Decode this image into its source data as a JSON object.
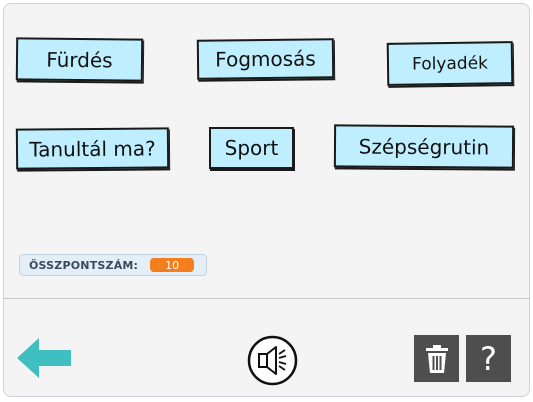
{
  "words": [
    {
      "label": "Fürdés"
    },
    {
      "label": "Fogmosás"
    },
    {
      "label": "Folyadék"
    },
    {
      "label": "Tanultál ma?"
    },
    {
      "label": "Sport"
    },
    {
      "label": "Szépségrutin"
    }
  ],
  "score": {
    "label": "ÖSSZPONTSZÁM:",
    "value": "10"
  },
  "controls": {
    "back_icon": "arrow-left-icon",
    "sound_icon": "speaker-icon",
    "trash_icon": "trash-icon",
    "help_label": "?"
  },
  "colors": {
    "card_bg": "#bfefff",
    "score_badge": "#f47e1b",
    "arrow": "#3fbfbf",
    "control_bg": "#4e4e4e"
  }
}
